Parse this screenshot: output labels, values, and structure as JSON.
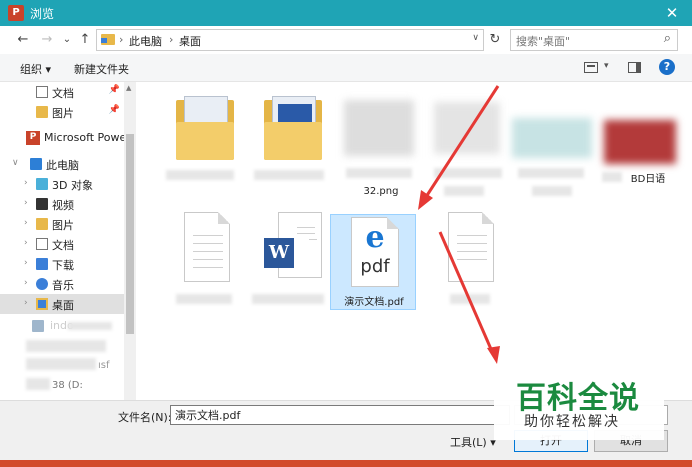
{
  "window": {
    "title": "浏览",
    "app_icon": "P",
    "close_glyph": "✕"
  },
  "address_bar": {
    "back_glyph": "←",
    "forward_glyph": "→",
    "recent_glyph": "⌄",
    "up_glyph": "↑",
    "crumbs": [
      "此电脑",
      "桌面"
    ],
    "crumb_sep": "›",
    "dropdown_glyph": "∨",
    "refresh_glyph": "↻",
    "search_placeholder": "搜索\"桌面\"",
    "search_glyph": "⌕"
  },
  "toolbar": {
    "organize_label": "组织 ▾",
    "new_folder_label": "新建文件夹",
    "view_dropdown_glyph": "▾",
    "help_glyph": "?"
  },
  "sidebar": {
    "pin_glyph": "📌",
    "items": [
      {
        "label": "文档",
        "icon": "document-icon",
        "pinned": true
      },
      {
        "label": "图片",
        "icon": "pictures-icon",
        "pinned": true
      },
      {
        "label": "Microsoft Powe",
        "icon": "powerpoint-icon",
        "pinned": false
      },
      {
        "label": "此电脑",
        "icon": "computer-icon",
        "pinned": false
      },
      {
        "label": "3D 对象",
        "icon": "3d-objects-icon",
        "pinned": false
      },
      {
        "label": "视频",
        "icon": "video-icon",
        "pinned": false
      },
      {
        "label": "图片",
        "icon": "pictures-icon",
        "pinned": false
      },
      {
        "label": "文档",
        "icon": "document-icon",
        "pinned": false
      },
      {
        "label": "下载",
        "icon": "download-icon",
        "pinned": false
      },
      {
        "label": "音乐",
        "icon": "music-icon",
        "pinned": false
      },
      {
        "label": "桌面",
        "icon": "desktop-icon",
        "pinned": false,
        "selected": true
      }
    ],
    "partial_labels": [
      "indo",
      "ısf",
      "38 (D:"
    ]
  },
  "content": {
    "files": [
      {
        "label": "32.png",
        "icon": "image-thumbnail-icon"
      },
      {
        "label": "BD日语",
        "icon": "image-thumbnail-icon"
      },
      {
        "label": "演示文档.pdf",
        "icon": "pdf-icon",
        "selected": true
      },
      {
        "label": "e",
        "pdf_text": "pdf"
      }
    ],
    "word_badge": "W"
  },
  "bottom": {
    "filename_label": "文件名(N):",
    "filename_value": "演示文档.pdf",
    "tools_label": "工具(L) ▾",
    "open_label": "打开",
    "cancel_label": "取消"
  },
  "watermark": {
    "title": "百科全说",
    "subtitle": "助你轻松解决"
  },
  "colors": {
    "titlebar": "#1fa4b5",
    "arrow": "#e53935",
    "selection": "#cce8ff",
    "watermark_green": "#1b8a3f"
  }
}
